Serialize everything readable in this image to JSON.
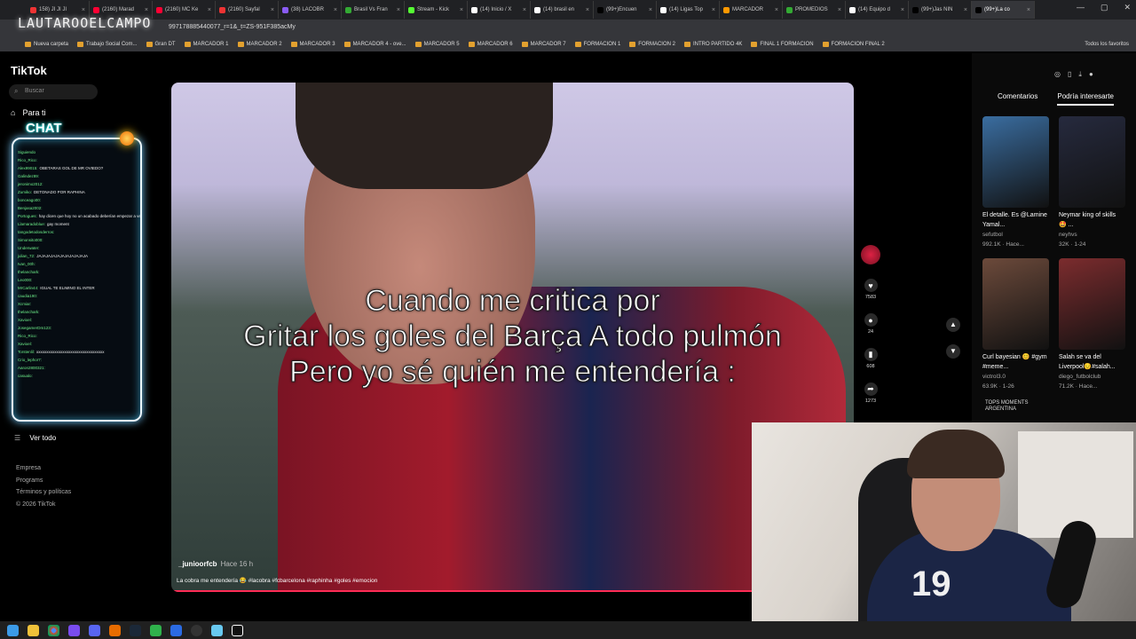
{
  "browser": {
    "tabs": [
      {
        "label": "158) JI JI JI"
      },
      {
        "label": "(2160) Marad"
      },
      {
        "label": "(2160) MC Ke"
      },
      {
        "label": "(2160) Sayfal"
      },
      {
        "label": "(38) LACOBR"
      },
      {
        "label": "Brasil Vs Fran"
      },
      {
        "label": "Stream - Kick"
      },
      {
        "label": "(14) Inicio / X"
      },
      {
        "label": "(14) brasil en"
      },
      {
        "label": "(99+)Encuen"
      },
      {
        "label": "(14) Ligas Top"
      },
      {
        "label": "MARCADOR"
      },
      {
        "label": "PROMEDIOS"
      },
      {
        "label": "(14) Equipo d"
      },
      {
        "label": "(99+)Jas NIN"
      },
      {
        "label": "(99+)La co",
        "active": true
      }
    ],
    "url": "997178885440077_r=1&_t=ZS-951F385acMy",
    "overlay_logo": "LAUTAROOELCAMPO",
    "bookmarks": [
      "Nueva carpeta",
      "Trabajo Social Com...",
      "Gran DT",
      "MARCADOR 1",
      "MARCADOR 2",
      "MARCADOR 3",
      "MARCADOR 4 - ove...",
      "MARCADOR 5",
      "MARCADOR 6",
      "MARCADOR 7",
      "FORMACION 1",
      "FORMACION 2",
      "INTRO PARTIDO 4K",
      "FINAL 1 FORMACION",
      "FORMACION FINAL 2"
    ],
    "bookmarks_right": "Todos los favoritos"
  },
  "sidebar": {
    "logo": "TikTok",
    "search_placeholder": "Buscar",
    "nav_foryou": "Para ti",
    "chat_title": "CHAT",
    "chat_lines": [
      {
        "user": "Siguiendo",
        "msg": ""
      },
      {
        "user": "Rico_Rico:",
        "msg": ""
      },
      {
        "user": "Alex99015:",
        "msg": "OBETARAS GOL DE MR OVIEDO?"
      },
      {
        "user": "Galindez89:",
        "msg": ""
      },
      {
        "user": "jeronimo2012:",
        "msg": ""
      },
      {
        "user": "Zumiko:",
        "msg": "DETONADO POR RAPHINA"
      },
      {
        "user": "bonceago00:",
        "msg": ""
      },
      {
        "user": "Benjasa2002:",
        "msg": ""
      },
      {
        "user": "Portogues:",
        "msg": "hay dicen que hoy no un acabado deberían empezar a ver fútbol de nuevo"
      },
      {
        "user": "Llamaradoblue:",
        "msg": "gay moment"
      },
      {
        "user": "tangodetodosderros:",
        "msg": ""
      },
      {
        "user": "Simonsito000:",
        "msg": ""
      },
      {
        "user": "Underwater:",
        "msg": ""
      },
      {
        "user": "julian_72:",
        "msg": "JAJAJAJAJAJAJAJAJAJAJA"
      },
      {
        "user": "Ivan_00h:",
        "msg": ""
      },
      {
        "user": "thelanchark:",
        "msg": ""
      },
      {
        "user": "Leo000:",
        "msg": ""
      },
      {
        "user": "MrCarlin44:",
        "msg": "IGUAL TE ELIMINO EL INTER"
      },
      {
        "user": "caudia190:",
        "msg": ""
      },
      {
        "user": "Xcmiar:",
        "msg": ""
      },
      {
        "user": "thelanchark:",
        "msg": ""
      },
      {
        "user": "Xavioel:",
        "msg": ""
      },
      {
        "user": "JosegamerDm123:",
        "msg": ""
      },
      {
        "user": "Rico_Rico:",
        "msg": ""
      },
      {
        "user": "Xavioel:",
        "msg": ""
      },
      {
        "user": "Torstenlil:",
        "msg": "xxxxxxxxxxxxxxxxxxxxxxxxxxxxxxxxxx"
      },
      {
        "user": "Crio_lephor7:",
        "msg": ""
      },
      {
        "user": "Aaron2800321:",
        "msg": ""
      },
      {
        "user": "casualo:",
        "msg": ""
      }
    ],
    "ver_todo": "Ver todo",
    "footer": [
      "Empresa",
      "Programs",
      "Términos y políticas",
      "© 2026 TikTok"
    ]
  },
  "video": {
    "caption_lines": [
      "Cuando me critica por",
      "Gritar los goles del Barça A todo pulmón",
      "Pero yo sé quién me entendería :"
    ],
    "author": "_junioorfcb",
    "time": "Hace 16 h",
    "description": "La cobra me entendería 😂 #lacobra #fcbarcelona #raphinha #goles #emocion",
    "progress": 1.0
  },
  "actions": {
    "likes": "7583",
    "comments": "24",
    "saves": "608",
    "shares": "1273"
  },
  "right_panel": {
    "tabs": [
      "Comentarios",
      "Podría interesarte"
    ],
    "items": [
      {
        "title": "El detalle. Es @Lamine Yamal...",
        "user": "sefutbol",
        "meta": "992.1K · Hace...",
        "color": "#3a6da0"
      },
      {
        "title": "Neymar king of skills 🤩 ...",
        "user": "neyhvs",
        "meta": "32K · 1-24",
        "color": "#262a3e"
      },
      {
        "title": "Curl bayesian 😊 #gym #meme...",
        "user": "victrol3.0",
        "meta": "63.9K · 1-26",
        "color": "#6c4a3b"
      },
      {
        "title": "Salah se va del Liverpool😔#salah...",
        "user": "diego_futbolclub",
        "meta": "71.2K · Hace...",
        "color": "#7c2c2e"
      }
    ],
    "badge_text": "TOPS MOMENTS ARGENTINA"
  },
  "webcam": {
    "jersey_number": "19"
  },
  "colors": {
    "accent": "#fe2c55",
    "chat_glow": "#7cf"
  }
}
